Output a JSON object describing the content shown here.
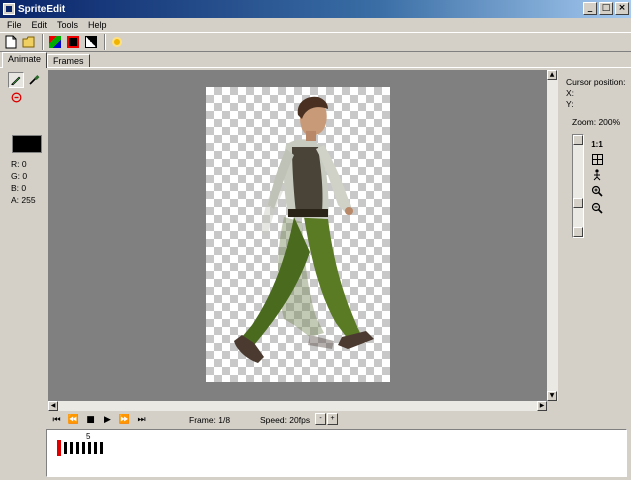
{
  "window": {
    "title": "SpriteEdit",
    "minimize": "_",
    "maximize": "□",
    "close": "×"
  },
  "menu": [
    "File",
    "Edit",
    "Tools",
    "Help"
  ],
  "tabs": [
    "Animate",
    "Frames"
  ],
  "color": {
    "r": "R: 0",
    "g": "G: 0",
    "b": "B: 0",
    "a": "A: 255"
  },
  "right": {
    "cursor_position": "Cursor position:",
    "x": "X:",
    "y": "Y:",
    "zoom": "Zoom: 200%",
    "one_to_one": "1:1"
  },
  "playback": {
    "frame": "Frame: 1/8",
    "speed": "Speed: 20fps",
    "speed_down": "-",
    "speed_up": "+"
  },
  "timeline": {
    "marker_label": "5",
    "frame_count": 8,
    "current_frame": 1
  },
  "colors": {
    "title_start": "#0a246a",
    "title_end": "#a6caf0",
    "canvas": "#808080",
    "current_frame": "#e00000"
  }
}
